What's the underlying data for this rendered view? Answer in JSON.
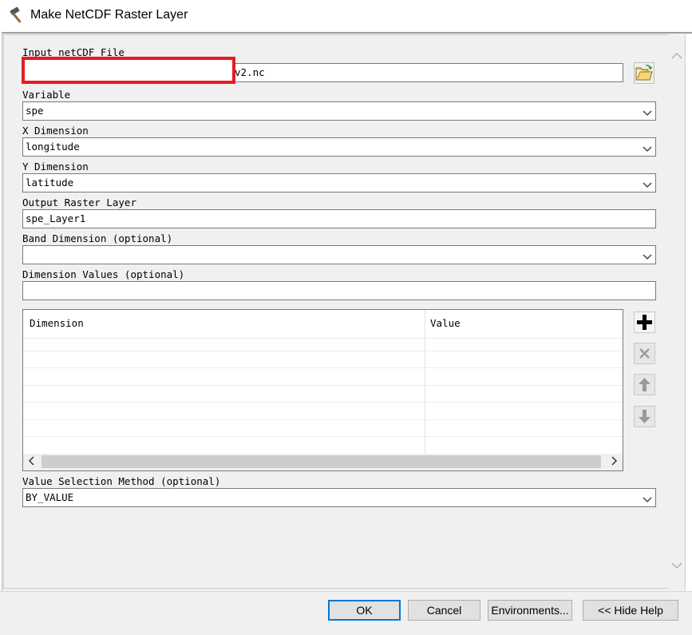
{
  "window": {
    "title": "Make NetCDF Raster Layer",
    "icon": "hammer-icon"
  },
  "fields": {
    "input_netcdf": {
      "label": "Input netCDF File",
      "value": "v2.nc"
    },
    "variable": {
      "label": "Variable",
      "value": "spe"
    },
    "x_dimension": {
      "label": "X Dimension",
      "value": "longitude"
    },
    "y_dimension": {
      "label": "Y Dimension",
      "value": "latitude"
    },
    "output_raster": {
      "label": "Output Raster Layer",
      "value": "spe_Layer1"
    },
    "band_dimension": {
      "label": "Band Dimension (optional)",
      "value": ""
    },
    "dimension_values": {
      "label": "Dimension Values (optional)",
      "value": ""
    },
    "value_selection": {
      "label": "Value Selection Method (optional)",
      "value": "BY_VALUE"
    }
  },
  "grid": {
    "columns": [
      "Dimension",
      "Value"
    ]
  },
  "buttons": {
    "ok": "OK",
    "cancel": "Cancel",
    "environments": "Environments...",
    "hide_help": "<< Hide Help"
  },
  "colors": {
    "redaction_border": "#e51c23",
    "ok_focus": "#0078d7"
  }
}
